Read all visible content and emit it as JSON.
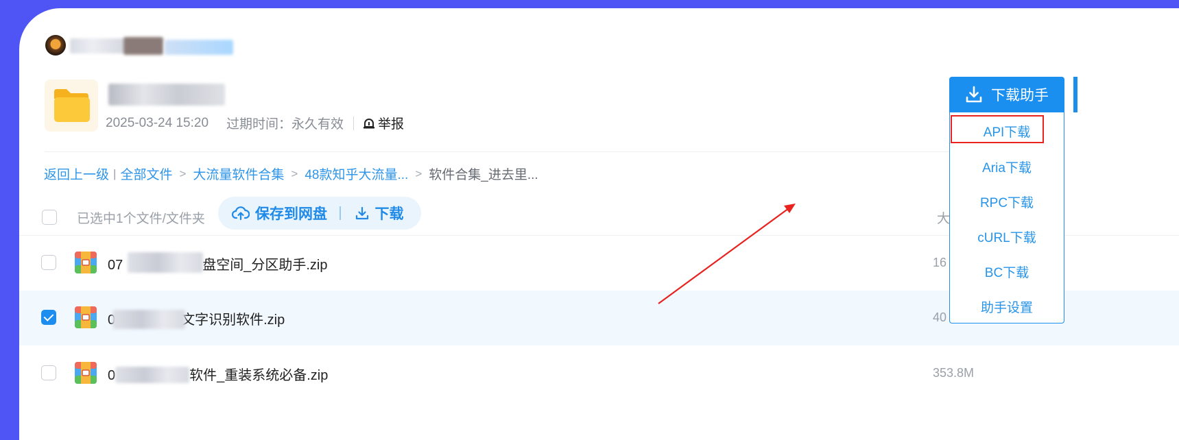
{
  "share": {
    "date": "2025-03-24 15:20",
    "expiry_label": "过期时间：永久有效",
    "report_label": "举报"
  },
  "breadcrumb": {
    "back": "返回上一级",
    "all_files": "全部文件",
    "level1": "大流量软件合集",
    "level2": "48款知乎大流量...",
    "current": "软件合集_进去里..."
  },
  "toolbar": {
    "selected_text": "已选中1个文件/文件夹",
    "save_label": "保存到网盘",
    "download_label": "下载",
    "size_header": "大"
  },
  "files": [
    {
      "name_prefix": "07",
      "name_suffix": "盘空间_分区助手.zip",
      "size": "16",
      "selected": false
    },
    {
      "name_prefix": "0",
      "name_suffix": "文字识别软件.zip",
      "size": "40",
      "selected": true
    },
    {
      "name_prefix": "0",
      "name_suffix": "软件_重装系统必备.zip",
      "size": "353.8M",
      "selected": false
    }
  ],
  "download_helper": {
    "button_label": "下载助手",
    "items": [
      "API下载",
      "Aria下载",
      "RPC下载",
      "cURL下载",
      "BC下载",
      "助手设置"
    ],
    "highlighted_item": "API下载"
  },
  "colors": {
    "background": "#4f55f5",
    "accent": "#1b8ff0",
    "highlight": "#e8221e"
  }
}
